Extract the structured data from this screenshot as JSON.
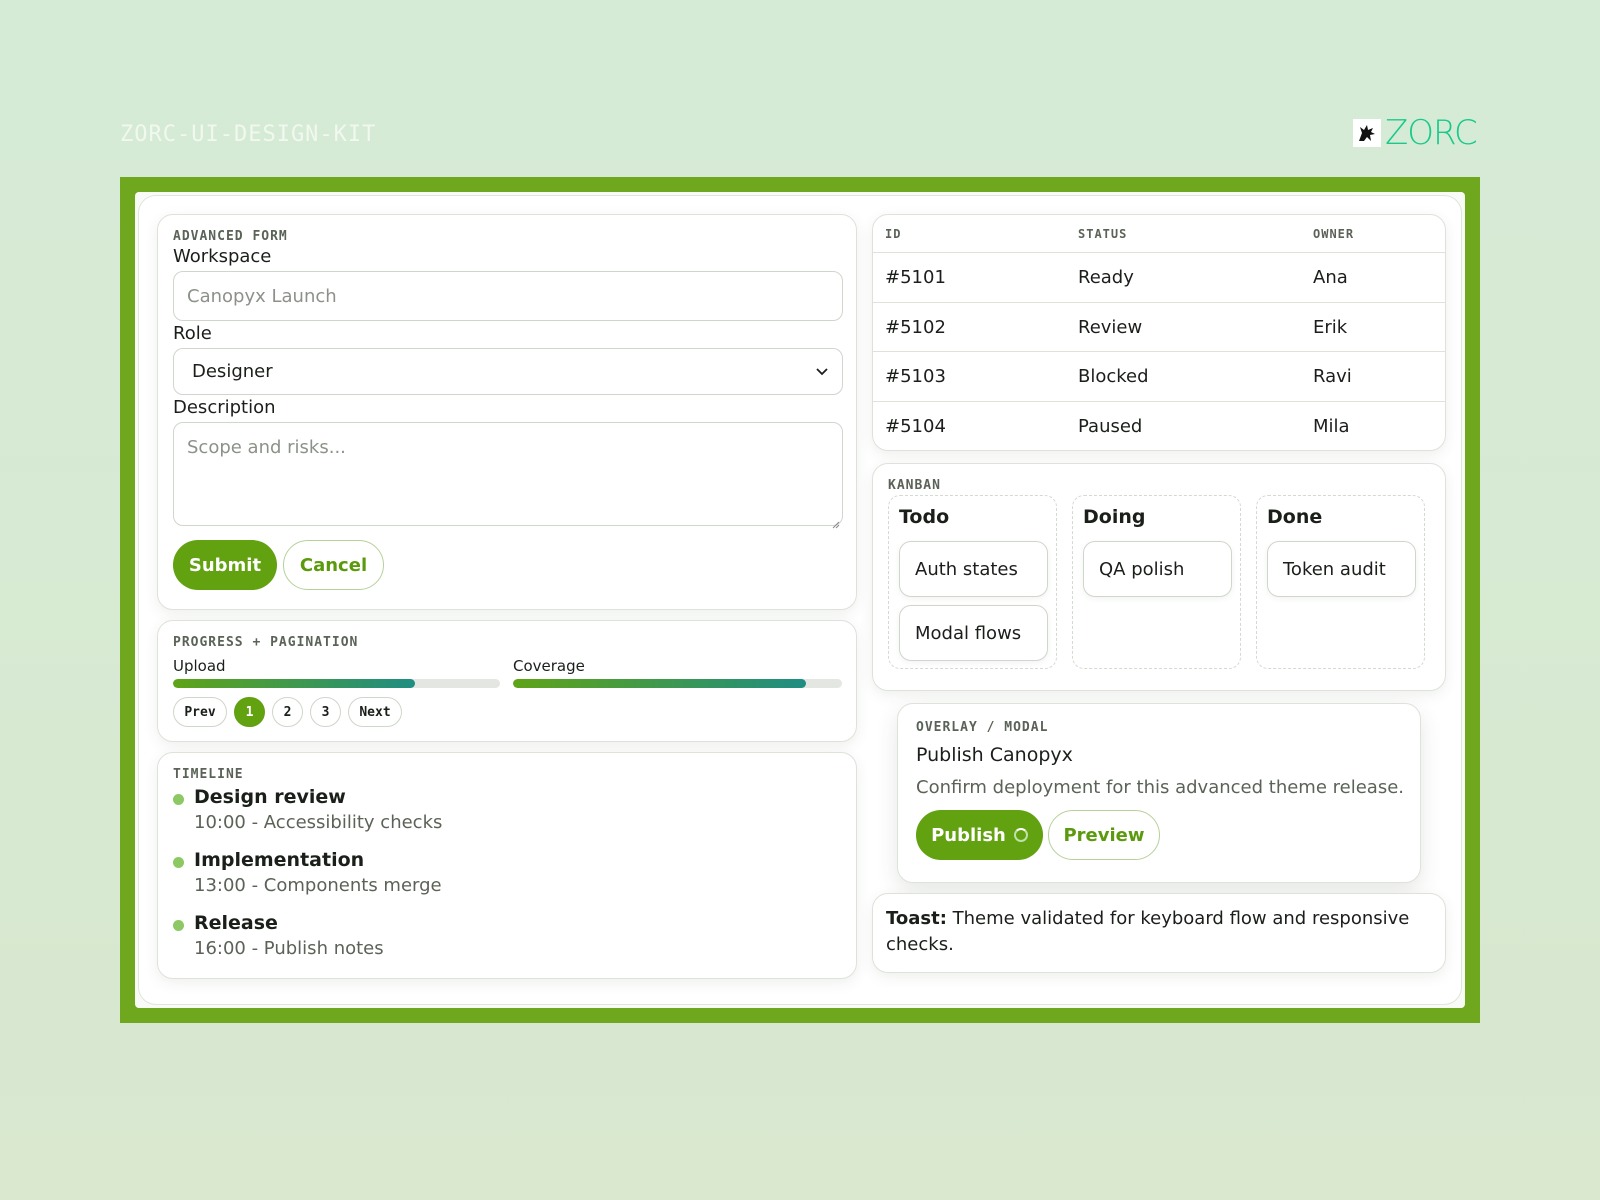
{
  "kit_title": "ZORC-UI-DESIGN-KIT",
  "brand": {
    "logo_text": "ZORC",
    "accent": "#62a10f",
    "logo_color": "#19c98b",
    "frame_color": "#6fa81f"
  },
  "form": {
    "eyebrow": "ADVANCED FORM",
    "workspace_label": "Workspace",
    "workspace_placeholder": "Canopyx Launch",
    "role_label": "Role",
    "role_value": "Designer",
    "description_label": "Description",
    "description_placeholder": "Scope and risks...",
    "submit_label": "Submit",
    "cancel_label": "Cancel"
  },
  "progress": {
    "eyebrow": "PROGRESS + PAGINATION",
    "bars": [
      {
        "label": "Upload",
        "value": 0.74
      },
      {
        "label": "Coverage",
        "value": 0.89
      }
    ],
    "pagination": {
      "prev": "Prev",
      "pages": [
        "1",
        "2",
        "3"
      ],
      "current": "1",
      "next": "Next"
    }
  },
  "timeline": {
    "eyebrow": "TIMELINE",
    "items": [
      {
        "title": "Design review",
        "detail": "10:00 - Accessibility checks"
      },
      {
        "title": "Implementation",
        "detail": "13:00 - Components merge"
      },
      {
        "title": "Release",
        "detail": "16:00 - Publish notes"
      }
    ]
  },
  "table": {
    "headers": [
      "ID",
      "STATUS",
      "OWNER"
    ],
    "rows": [
      [
        "#5101",
        "Ready",
        "Ana"
      ],
      [
        "#5102",
        "Review",
        "Erik"
      ],
      [
        "#5103",
        "Blocked",
        "Ravi"
      ],
      [
        "#5104",
        "Paused",
        "Mila"
      ]
    ]
  },
  "kanban": {
    "eyebrow": "KANBAN",
    "columns": [
      {
        "title": "Todo",
        "cards": [
          "Auth states",
          "Modal flows"
        ]
      },
      {
        "title": "Doing",
        "cards": [
          "QA polish"
        ]
      },
      {
        "title": "Done",
        "cards": [
          "Token audit"
        ]
      }
    ]
  },
  "modal": {
    "eyebrow": "OVERLAY / MODAL",
    "title": "Publish Canopyx",
    "message": "Confirm deployment for this advanced theme release.",
    "publish_label": "Publish",
    "preview_label": "Preview"
  },
  "toast": {
    "label": "Toast:",
    "message": "Theme validated for keyboard flow and responsive checks."
  }
}
